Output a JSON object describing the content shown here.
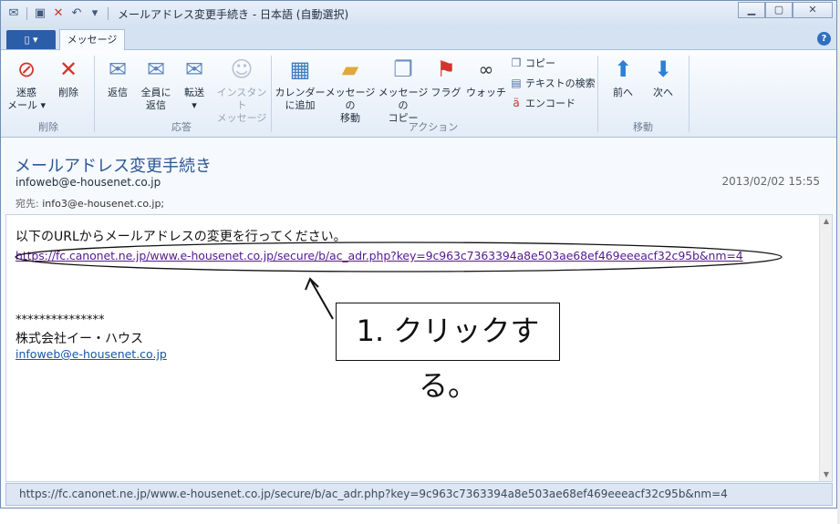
{
  "window": {
    "title": "メールアドレス変更手続き - 日本語 (自動選択)",
    "qat": [
      "mail-icon",
      "save-icon",
      "delete-icon",
      "reply-icon",
      "dropdown-icon"
    ],
    "controls": [
      "minimize-icon",
      "maximize-icon",
      "close-icon"
    ]
  },
  "tabs": {
    "file_label": "▯ ▾",
    "message_label": "メッセージ",
    "help": "?"
  },
  "ribbon": {
    "groups": {
      "delete": "削除",
      "respond": "応答",
      "actions": "アクション",
      "move": "移動"
    },
    "buttons": {
      "junk_l1": "迷惑",
      "junk_l2": "メール ▾",
      "delete": "削除",
      "reply": "返信",
      "reply_all_l1": "全員に",
      "reply_all_l2": "返信",
      "forward_l1": "転送",
      "forward_l2": "▾",
      "im_l1": "インスタント",
      "im_l2": "メッセージ",
      "calendar_l1": "カレンダー",
      "calendar_l2": "に追加",
      "move_msg_l1": "メッセージの",
      "move_msg_l2": "移動",
      "copy_msg_l1": "メッセージの",
      "copy_msg_l2": "コピー",
      "flag": "フラグ",
      "watch": "ウォッチ",
      "copy": "コピー",
      "find_text": "テキストの検索",
      "encode": "エンコード",
      "prev": "前へ",
      "next": "次へ"
    }
  },
  "message": {
    "subject": "メールアドレス変更手続き",
    "from": "infoweb@e-housenet.co.jp",
    "date": "2013/02/02 15:55",
    "to_label": "宛先:",
    "to": "info3@e-housenet.co.jp;",
    "body_line1": "以下のURLからメールアドレスの変更を行ってください。",
    "body_link": "https://fc.canonet.ne.jp/www.e-housenet.co.jp/secure/b/ac_adr.php?key=9c963c7363394a8e503ae68ef469eeeacf32c95b&nm=4",
    "stars": "***************",
    "company": "株式会社イー・ハウス",
    "signature_email": "infoweb@e-housenet.co.jp"
  },
  "annotation": {
    "callout": "1. クリックする。"
  },
  "status_bar": {
    "url": "https://fc.canonet.ne.jp/www.e-housenet.co.jp/secure/b/ac_adr.php?key=9c963c7363394a8e503ae68ef469eeeacf32c95b&nm=4"
  },
  "colors": {
    "accent": "#2b5797",
    "file_tab": "#2b5ea8",
    "visited_link": "#551a8b",
    "link": "#1a55a6"
  }
}
